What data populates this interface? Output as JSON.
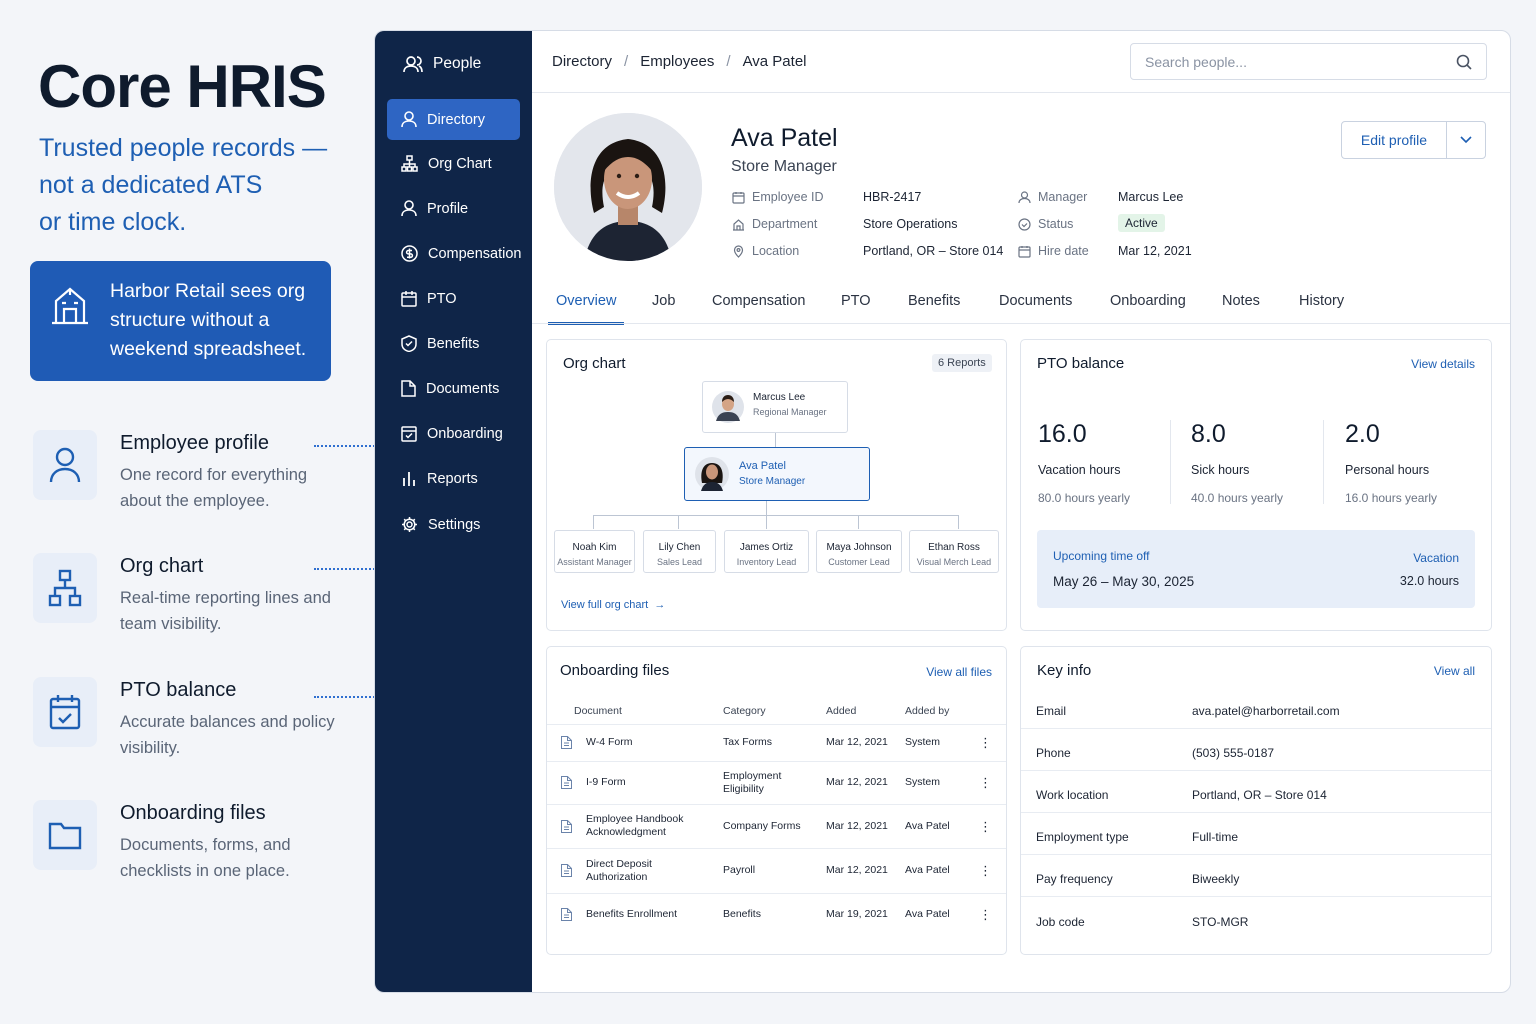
{
  "hero": {
    "title": "Core HRIS",
    "subtitle_lines": [
      "Trusted people records —",
      "not a dedicated ATS",
      "or time clock."
    ],
    "callout_lines": [
      "Harbor Retail sees org",
      "structure without a",
      "weekend spreadsheet."
    ]
  },
  "features": [
    {
      "title": "Employee profile",
      "desc": "One record for everything about the employee.",
      "icon": "person-icon"
    },
    {
      "title": "Org chart",
      "desc": "Real-time reporting lines and team visibility.",
      "icon": "org-chart-icon"
    },
    {
      "title": "PTO balance",
      "desc": "Accurate balances and policy visibility.",
      "icon": "calendar-check-icon"
    },
    {
      "title": "Onboarding files",
      "desc": "Documents, forms, and checklists in one place.",
      "icon": "folder-icon"
    }
  ],
  "sidebar": {
    "header": "People",
    "items": [
      {
        "label": "Directory",
        "icon": "person-icon",
        "active": true
      },
      {
        "label": "Org Chart",
        "icon": "org-chart-icon"
      },
      {
        "label": "Profile",
        "icon": "person-icon"
      },
      {
        "label": "Compensation",
        "icon": "dollar-icon"
      },
      {
        "label": "PTO",
        "icon": "calendar-icon"
      },
      {
        "label": "Benefits",
        "icon": "shield-icon"
      },
      {
        "label": "Documents",
        "icon": "document-icon"
      },
      {
        "label": "Onboarding",
        "icon": "checklist-icon"
      },
      {
        "label": "Reports",
        "icon": "bar-chart-icon"
      },
      {
        "label": "Settings",
        "icon": "gear-icon"
      }
    ]
  },
  "breadcrumb": [
    "Directory",
    "Employees",
    "Ava Patel"
  ],
  "search": {
    "placeholder": "Search people..."
  },
  "profile": {
    "name": "Ava Patel",
    "role": "Store Manager",
    "edit_label": "Edit profile",
    "meta": {
      "employee_id_label": "Employee ID",
      "employee_id": "HBR-2417",
      "department_label": "Department",
      "department": "Store Operations",
      "location_label": "Location",
      "location": "Portland, OR – Store 014",
      "manager_label": "Manager",
      "manager": "Marcus Lee",
      "status_label": "Status",
      "status": "Active",
      "hire_label": "Hire date",
      "hire_date": "Mar 12, 2021"
    }
  },
  "tabs": [
    "Overview",
    "Job",
    "Compensation",
    "PTO",
    "Benefits",
    "Documents",
    "Onboarding",
    "Notes",
    "History"
  ],
  "org": {
    "title": "Org chart",
    "reports_badge": "6 Reports",
    "manager": {
      "name": "Marcus Lee",
      "title": "Regional Manager"
    },
    "self": {
      "name": "Ava Patel",
      "title": "Store Manager"
    },
    "reports": [
      {
        "name": "Noah Kim",
        "title": "Assistant Manager"
      },
      {
        "name": "Lily Chen",
        "title": "Sales Lead"
      },
      {
        "name": "James Ortiz",
        "title": "Inventory Lead"
      },
      {
        "name": "Maya Johnson",
        "title": "Customer Lead"
      },
      {
        "name": "Ethan Ross",
        "title": "Visual Merch Lead"
      }
    ],
    "link": "View full org chart"
  },
  "pto": {
    "title": "PTO balance",
    "link": "View details",
    "balances": [
      {
        "value": "16.0",
        "label": "Vacation hours",
        "yearly": "80.0 hours yearly"
      },
      {
        "value": "8.0",
        "label": "Sick hours",
        "yearly": "40.0 hours yearly"
      },
      {
        "value": "2.0",
        "label": "Personal hours",
        "yearly": "16.0 hours yearly"
      }
    ],
    "upcoming": {
      "label": "Upcoming time off",
      "type": "Vacation",
      "dates": "May 26 – May 30, 2025",
      "hours": "32.0 hours"
    }
  },
  "files": {
    "title": "Onboarding files",
    "link": "View all files",
    "columns": [
      "Document",
      "Category",
      "Added",
      "Added by"
    ],
    "rows": [
      {
        "doc": "W-4 Form",
        "cat": "Tax Forms",
        "added": "Mar 12, 2021",
        "by": "System"
      },
      {
        "doc": "I-9 Form",
        "cat": "Employment Eligibility",
        "added": "Mar 12, 2021",
        "by": "System"
      },
      {
        "doc": "Employee Handbook Acknowledgment",
        "cat": "Company Forms",
        "added": "Mar 12, 2021",
        "by": "Ava Patel"
      },
      {
        "doc": "Direct Deposit Authorization",
        "cat": "Payroll",
        "added": "Mar 12, 2021",
        "by": "Ava Patel"
      },
      {
        "doc": "Benefits Enrollment",
        "cat": "Benefits",
        "added": "Mar 19, 2021",
        "by": "Ava Patel"
      }
    ]
  },
  "keyinfo": {
    "title": "Key info",
    "link": "View all",
    "rows": [
      {
        "k": "Email",
        "v": "ava.patel@harborretail.com"
      },
      {
        "k": "Phone",
        "v": "(503) 555-0187"
      },
      {
        "k": "Work location",
        "v": "Portland, OR – Store 014"
      },
      {
        "k": "Employment type",
        "v": "Full-time"
      },
      {
        "k": "Pay frequency",
        "v": "Biweekly"
      },
      {
        "k": "Job code",
        "v": "STO-MGR"
      }
    ]
  },
  "colors": {
    "brand": "#1f5bb5",
    "sidebar": "#0f2548",
    "accent": "#1e5fb3",
    "active_badge": "#1f8a47"
  }
}
